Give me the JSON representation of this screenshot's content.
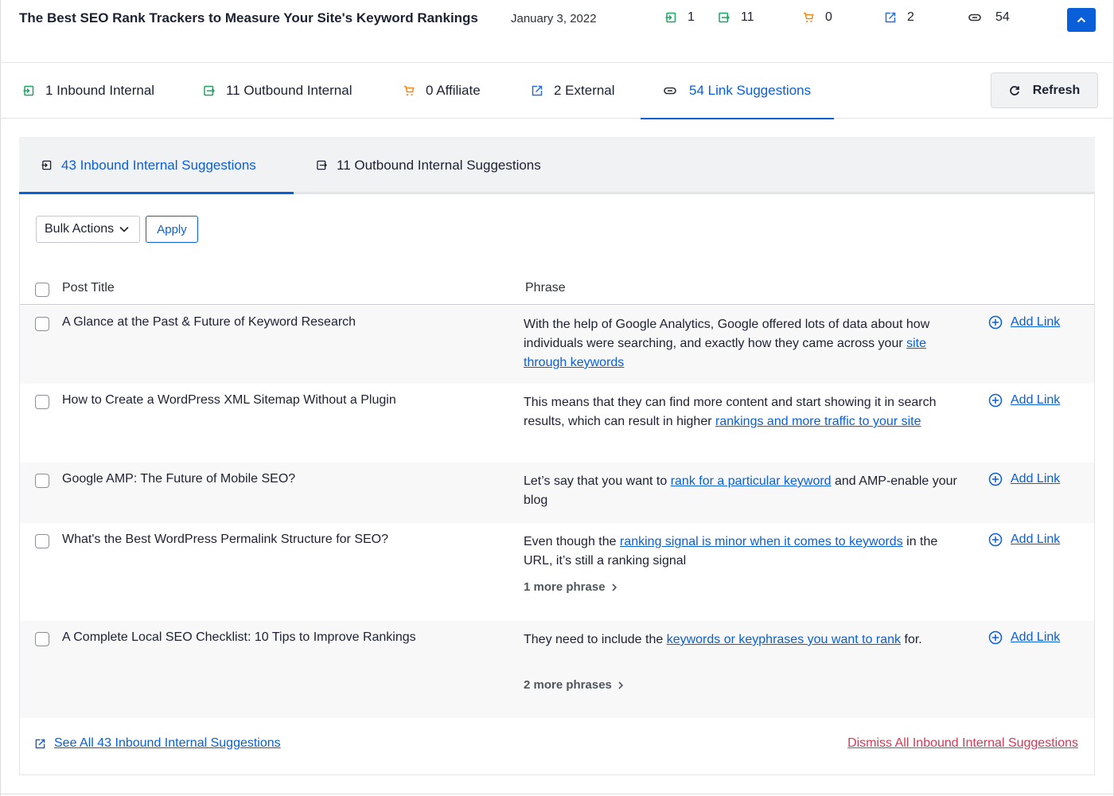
{
  "header": {
    "post_title": "The Best SEO Rank Trackers to Measure Your Site's Keyword Rankings",
    "date": "January 3, 2022",
    "stats": [
      {
        "name": "inbound-internal",
        "icon": "inbound-icon",
        "value": "1",
        "color": "#1ea362"
      },
      {
        "name": "outbound-internal",
        "icon": "outbound-icon",
        "value": "11",
        "color": "#1ea362"
      },
      {
        "name": "affiliate",
        "icon": "cart-icon",
        "value": "0",
        "color": "#f0891e"
      },
      {
        "name": "external",
        "icon": "external-link-icon",
        "value": "2",
        "color": "#2c6fd6"
      },
      {
        "name": "link-suggestions",
        "icon": "link-icon",
        "value": "54",
        "color": "#2c3338"
      }
    ],
    "collapse_icon": "chevron-up-icon"
  },
  "main_tabs": [
    {
      "label": "1 Inbound Internal",
      "icon": "inbound-icon",
      "active": false
    },
    {
      "label": "11 Outbound Internal",
      "icon": "outbound-icon",
      "active": false
    },
    {
      "label": "0 Affiliate",
      "icon": "cart-icon",
      "active": false
    },
    {
      "label": "2 External",
      "icon": "external-link-icon",
      "active": false
    },
    {
      "label": "54 Link Suggestions",
      "icon": "link-icon",
      "active": true
    }
  ],
  "refresh_label": "Refresh",
  "sub_tabs": [
    {
      "label": "43 Inbound Internal Suggestions",
      "active": true
    },
    {
      "label": "11 Outbound Internal Suggestions",
      "active": false
    }
  ],
  "bulk": {
    "select_value": "Bulk Actions",
    "apply_label": "Apply"
  },
  "table": {
    "headers": {
      "post_title": "Post Title",
      "phrase": "Phrase"
    },
    "rows": [
      {
        "title": "A Glance at the Past & Future of Keyword Research",
        "phrase_before": "With the help of Google Analytics, Google offered lots of data about how individuals were searching, and exactly how they came across your ",
        "phrase_link": "site through keywords",
        "phrase_after": "",
        "more": "",
        "action": "Add Link"
      },
      {
        "title": "How to Create a WordPress XML Sitemap Without a Plugin",
        "phrase_before": "This means that they can find more content and start showing it in search results, which can result in higher ",
        "phrase_link": "rankings and more traffic to your site",
        "phrase_after": "",
        "more": "",
        "action": "Add Link"
      },
      {
        "title": "Google AMP: The Future of Mobile SEO?",
        "phrase_before": "Let’s say that you want to ",
        "phrase_link": "rank for a particular keyword",
        "phrase_after": " and AMP-enable your blog",
        "more": "",
        "action": "Add Link"
      },
      {
        "title": "What's the Best WordPress Permalink Structure for SEO?",
        "phrase_before": "Even though the ",
        "phrase_link": "ranking signal is minor when it comes to keywords",
        "phrase_after": " in the URL, it’s still a ranking signal",
        "more": "1 more phrase",
        "action": "Add Link"
      },
      {
        "title": "A Complete Local SEO Checklist: 10 Tips to Improve Rankings",
        "phrase_before": "They need to include the ",
        "phrase_link": "keywords or keyphrases you want to rank",
        "phrase_after": " for.",
        "more": "2 more phrases",
        "action": "Add Link"
      }
    ]
  },
  "footer": {
    "see_all": "See All 43 Inbound Internal Suggestions",
    "dismiss_all": "Dismiss All Inbound Internal Suggestions"
  },
  "colors": {
    "accent": "#0a5fd8",
    "danger": "#d63955",
    "green": "#1ea362",
    "orange": "#f0891e"
  }
}
